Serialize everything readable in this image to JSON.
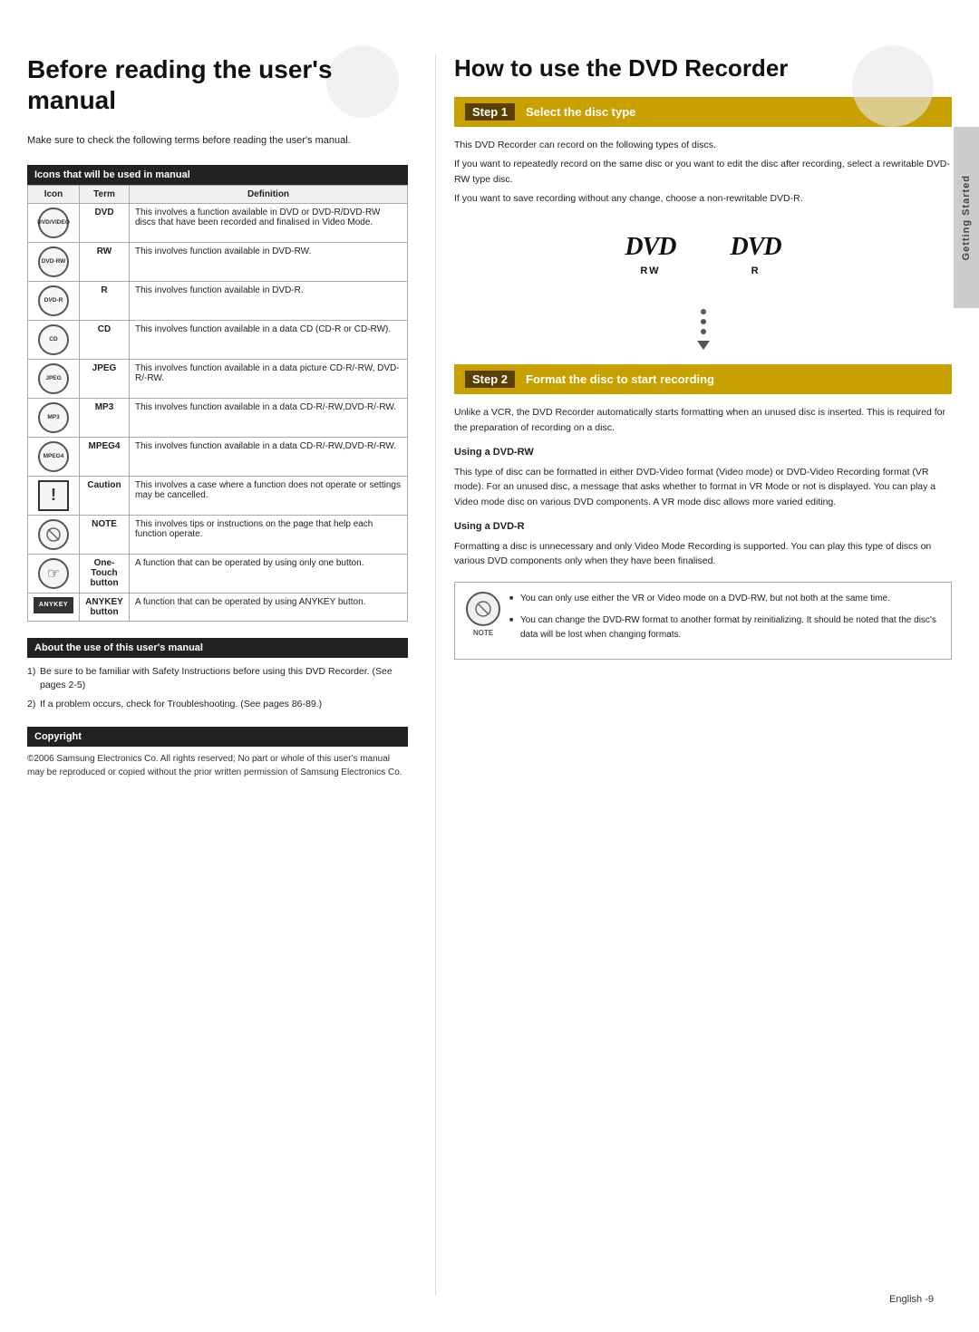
{
  "page": {
    "sidebar_label": "Getting Started",
    "footer": "English -9"
  },
  "left": {
    "title": "Before reading the user's manual",
    "intro": "Make sure to check the following terms before reading the user's manual.",
    "icons_section_header": "Icons that will be used in manual",
    "table_headers": [
      "Icon",
      "Term",
      "Definition"
    ],
    "table_rows": [
      {
        "icon_type": "circle",
        "icon_label": "DVD/VIDEO",
        "term": "DVD",
        "definition": "This involves a function available in DVD or DVD-R/DVD-RW discs that have been recorded and finalised in Video Mode."
      },
      {
        "icon_type": "circle",
        "icon_label": "DVD-RW",
        "term": "RW",
        "definition": "This involves function available in DVD-RW."
      },
      {
        "icon_type": "circle",
        "icon_label": "DVD-R",
        "term": "R",
        "definition": "This involves function available in DVD-R."
      },
      {
        "icon_type": "circle",
        "icon_label": "CD",
        "term": "CD",
        "definition": "This involves function available in a data CD (CD-R or CD-RW)."
      },
      {
        "icon_type": "circle",
        "icon_label": "JPEG",
        "term": "JPEG",
        "definition": "This involves function available in a data picture CD-R/-RW, DVD-R/-RW."
      },
      {
        "icon_type": "circle",
        "icon_label": "MP3",
        "term": "MP3",
        "definition": "This involves function available in a data CD-R/-RW,DVD-R/-RW."
      },
      {
        "icon_type": "circle",
        "icon_label": "MPEG4",
        "term": "MPEG4",
        "definition": "This involves function available in a data CD-R/-RW,DVD-R/-RW."
      },
      {
        "icon_type": "exclaim",
        "icon_label": "!",
        "term": "Caution",
        "definition": "This involves a case where a function does not operate or settings may be cancelled."
      },
      {
        "icon_type": "note",
        "icon_label": "NOTE",
        "term": "NOTE",
        "definition": "This involves tips or instructions on the page that help each function operate."
      },
      {
        "icon_type": "hand",
        "icon_label": "☞",
        "term": "One-Touch button",
        "definition": "A function that can be operated by using only one button."
      },
      {
        "icon_type": "anykey",
        "icon_label": "ANYKEY",
        "term": "ANYKEY button",
        "definition": "A function that can be operated by using ANYKEY button."
      }
    ],
    "about_section_header": "About the use of this user's manual",
    "about_items": [
      "Be sure to be familiar with Safety Instructions before using this DVD Recorder. (See pages 2-5)",
      "If a problem occurs, check for Troubleshooting. (See pages 86-89.)"
    ],
    "copyright_header": "Copyright",
    "copyright_text": "©2006 Samsung Electronics Co.\nAll rights reserved; No part or whole of this user's manual may be reproduced or copied without the prior written permission of Samsung Electronics Co."
  },
  "right": {
    "title": "How to use the DVD Recorder",
    "step1": {
      "number": "Step 1",
      "label": "Select the disc type",
      "description1": "This DVD Recorder can record on the following types of discs.",
      "description2": "If you want to repeatedly record on the same disc or you want to edit the disc after recording, select a rewritable DVD-RW type disc.",
      "description3": "If you want to save recording without any change, choose a non-rewritable DVD-R.",
      "dvd_rw_label": "RW",
      "dvd_r_label": "R"
    },
    "step2": {
      "number": "Step 2",
      "label": "Format the disc to start recording",
      "description": "Unlike a VCR, the DVD Recorder automatically starts formatting when an unused disc is inserted. This is required for the preparation of recording on a disc.",
      "using_dvdrw_title": "Using a DVD-RW",
      "using_dvdrw_text": "This type of disc can be formatted in either DVD-Video format (Video mode) or DVD-Video Recording format (VR mode). For an unused disc, a message that asks whether to format in VR Mode or not is displayed. You can play a Video mode disc on various DVD components. A VR mode disc allows more varied editing.",
      "using_dvdr_title": "Using a DVD-R",
      "using_dvdr_text": "Formatting a disc is unnecessary and only Video Mode Recording is supported. You can play this type of discs on various DVD components only when they have been finalised.",
      "note_items": [
        "You can only use either the VR or Video mode on a DVD-RW, but not both at the same time.",
        "You can change the DVD-RW format to another format by reinitializing. It should be noted that the disc's data will be lost when changing formats."
      ]
    }
  }
}
